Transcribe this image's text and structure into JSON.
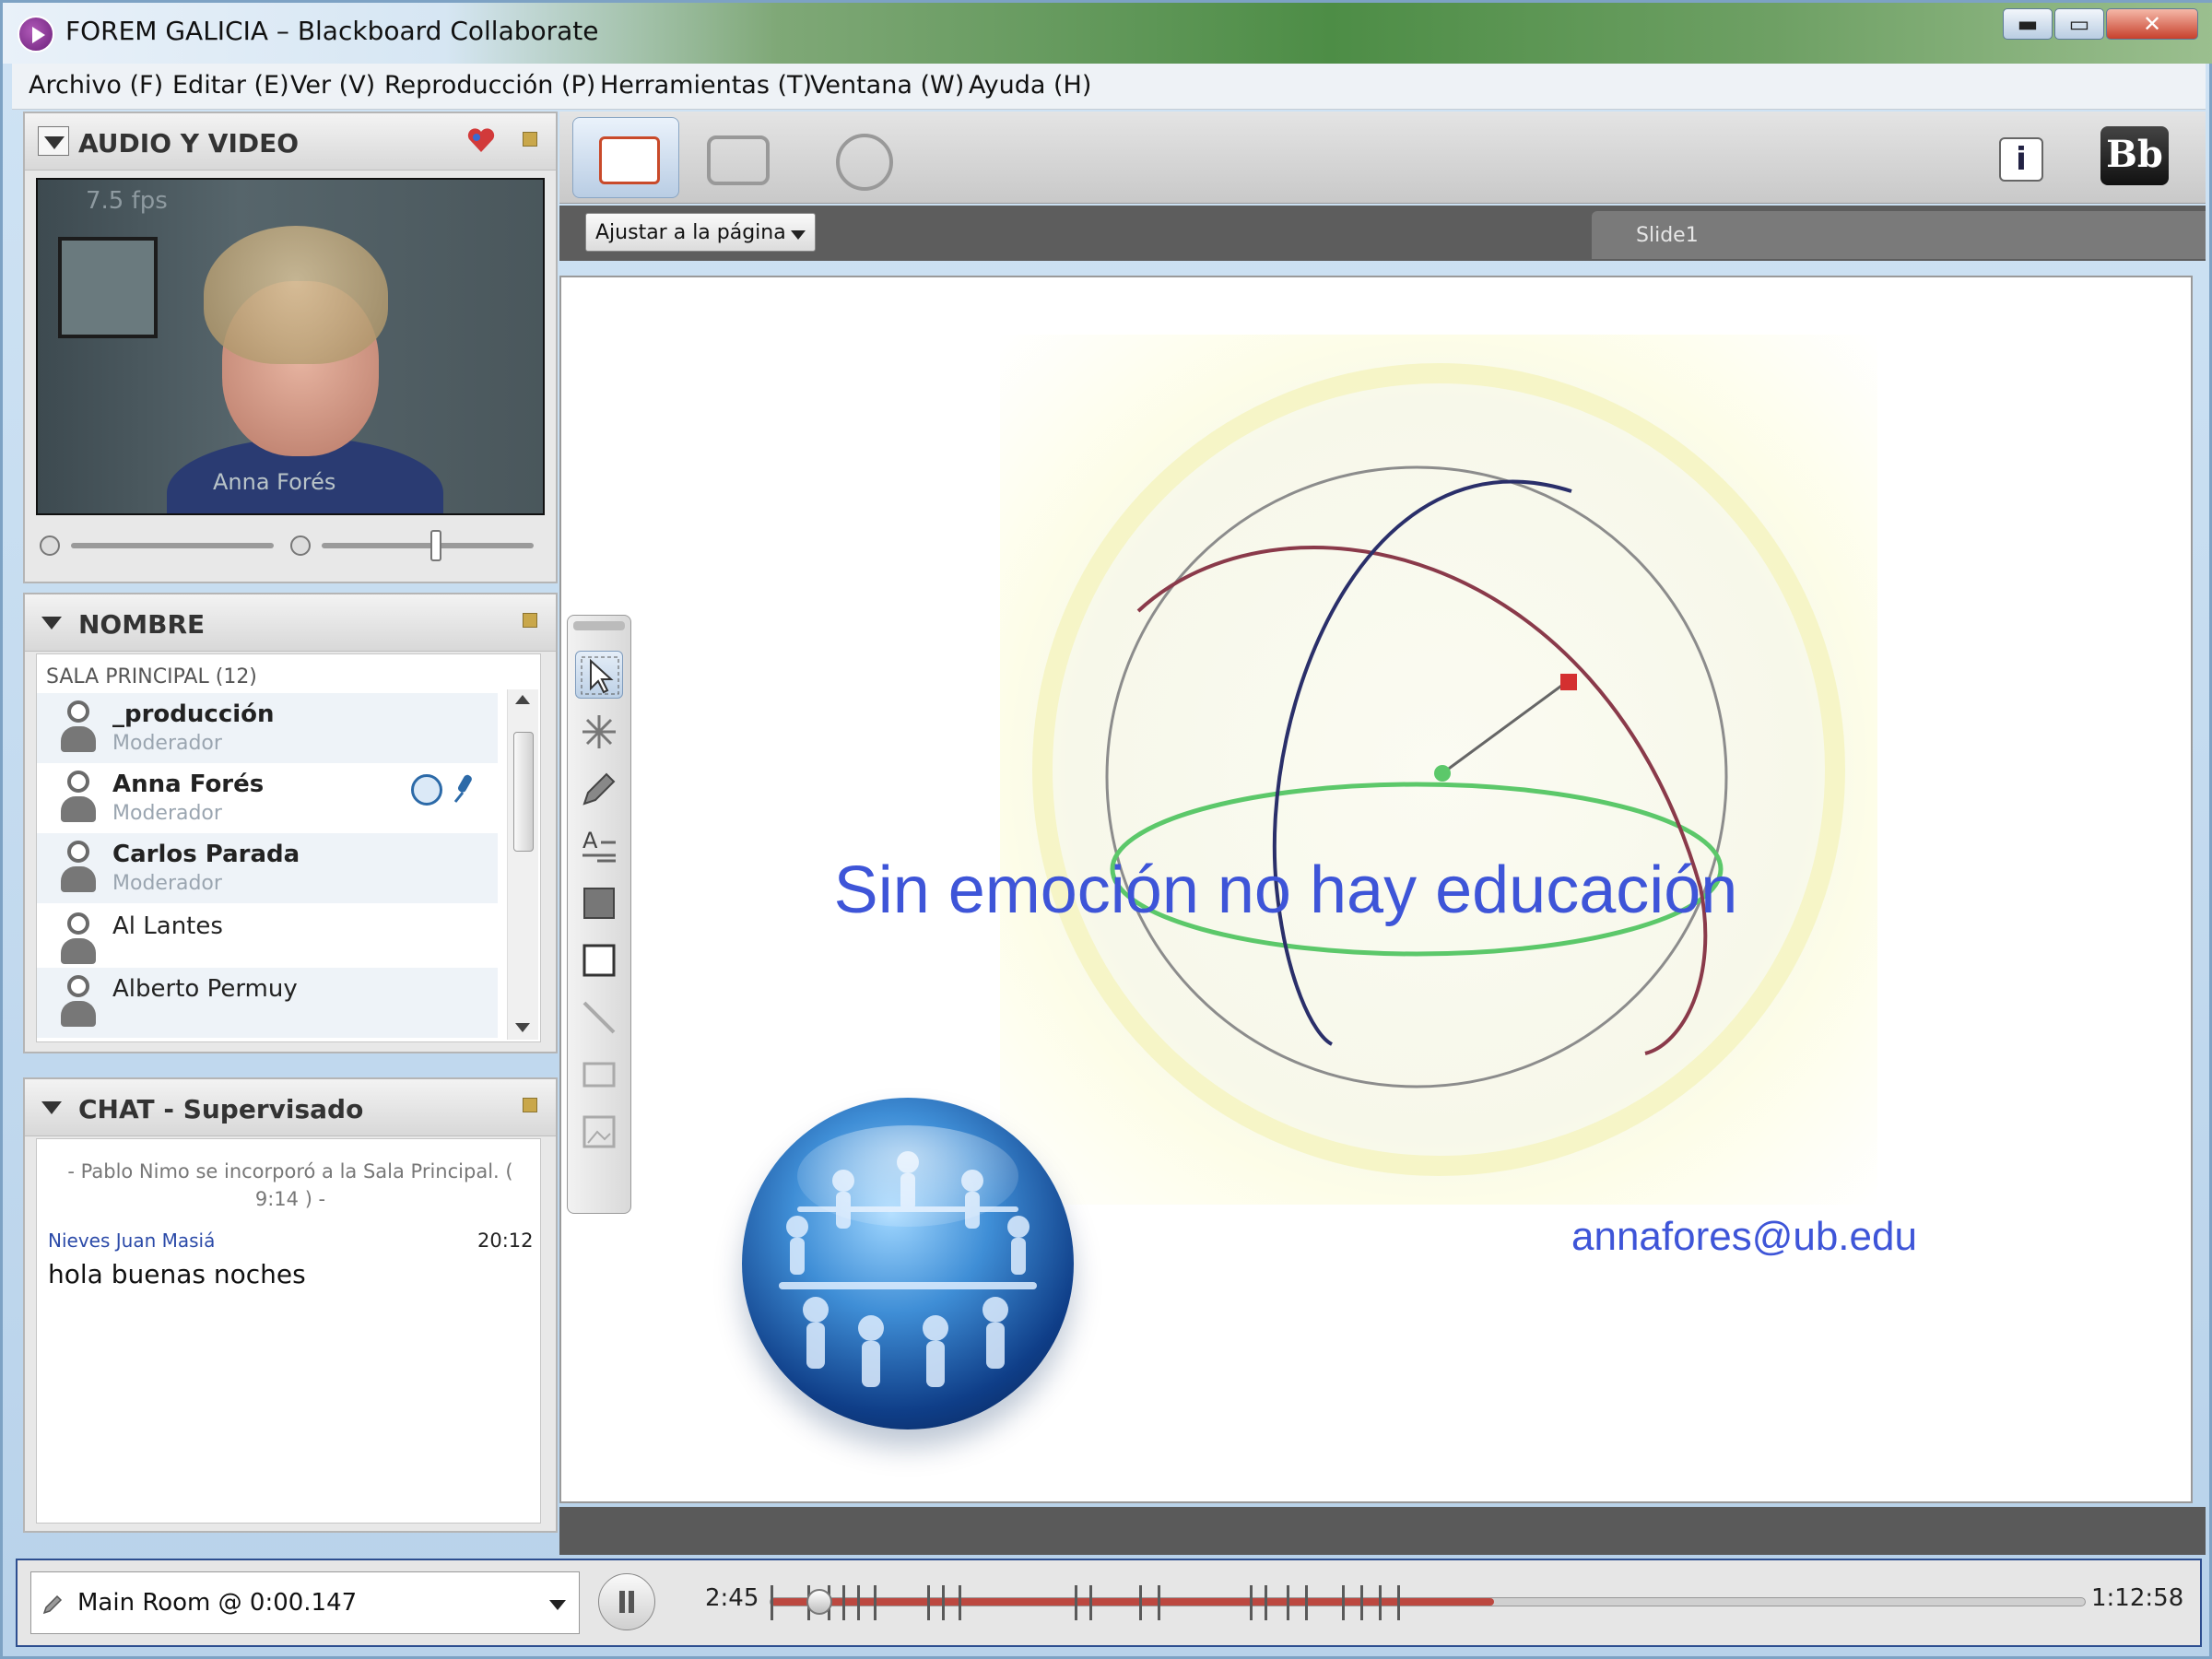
{
  "window": {
    "title": "FOREM GALICIA – Blackboard Collaborate",
    "close_symbol": "✕",
    "minimize_symbol": "▬",
    "maximize_symbol": "▭"
  },
  "menu": [
    "Archivo (F)",
    "Editar (E)",
    "Ver (V)",
    "Reproducción (P)",
    "Herramientas (T)",
    "Ventana (W)",
    "Ayuda (H)"
  ],
  "audio_panel": {
    "title": "AUDIO Y VIDEO",
    "fps": "7.5 fps",
    "speaker_name": "Anna Forés",
    "volume_level": 0.6
  },
  "names_panel": {
    "title": "NOMBRE",
    "room_label": "SALA PRINCIPAL  (12)",
    "participants": [
      {
        "name": "_producción",
        "role": "Moderador"
      },
      {
        "name": "Anna Forés",
        "role": "Moderador"
      },
      {
        "name": "Carlos Parada",
        "role": "Moderador"
      },
      {
        "name": "Al Lantes",
        "role": ""
      },
      {
        "name": "Alberto Permuy",
        "role": ""
      }
    ]
  },
  "chat_panel": {
    "title": "CHAT - Supervisado",
    "system_message": "- Pablo Nimo se incorporó a la Sala Principal. ( 9:14 ) -",
    "messages": [
      {
        "user": "Nieves Juan Masiá",
        "time": "20:12",
        "text": "hola buenas noches"
      }
    ]
  },
  "toolbar": {
    "info_label": "i",
    "bb_label": "Bb"
  },
  "view": {
    "fit_select": "Ajustar a la página",
    "slide_tab": "Slide1"
  },
  "slide": {
    "title": "Sin emoción no hay educación",
    "email": "annafores@ub.edu"
  },
  "playback": {
    "room": "Main Room @ 0:00.147",
    "current_time": "2:45",
    "total_time": "1:12:58",
    "progress": 0.037
  },
  "colors": {
    "slide_text": "#3e55d8",
    "playbar_accent": "#b83026"
  },
  "icons": [
    "app-logo-icon",
    "audio-settings-icon",
    "panel-menu-icon",
    "moderator-icon",
    "microphone-icon",
    "whiteboard-icon",
    "app-share-icon",
    "web-tour-icon",
    "info-icon",
    "blackboard-logo-icon",
    "select-tool-icon",
    "laser-pointer-icon",
    "pencil-tool-icon",
    "text-tool-icon",
    "filled-rect-icon",
    "hollow-rect-icon",
    "line-tool-icon",
    "screen-capture-icon",
    "clip-art-icon",
    "pause-icon"
  ]
}
